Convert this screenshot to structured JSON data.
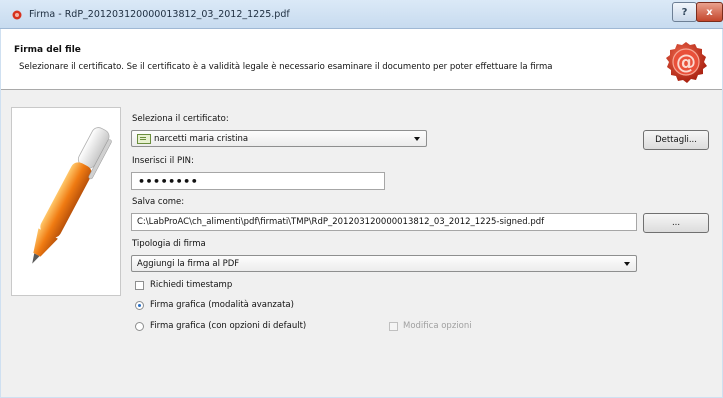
{
  "window": {
    "title": "Firma - RdP_201203120000013812_03_2012_1225.pdf",
    "help_label": "?",
    "close_label": "x"
  },
  "header": {
    "title": "Firma del file",
    "subtitle": "Selezionare il certificato. Se il certificato è a validità legale è necessario esaminare il documento per poter effettuare la firma"
  },
  "form": {
    "certificate_label": "Seleziona il certificato:",
    "certificate_value": "narcetti maria cristina",
    "details_button": "Dettagli...",
    "pin_label": "Inserisci il PIN:",
    "pin_value": "••••••••",
    "save_label": "Salva come:",
    "save_value": "C:\\LabProAC\\ch_alimenti\\pdf\\firmati\\TMP\\RdP_201203120000013812_03_2012_1225-signed.pdf",
    "browse_button": "...",
    "signature_type_label": "Tipologia di firma",
    "signature_type_value": "Aggiungi la firma al PDF",
    "timestamp_label": "Richiedi timestamp",
    "radio_advanced_label": "Firma grafica (modalità avanzata)",
    "radio_default_label": "Firma grafica (con opzioni di default)",
    "modify_options_label": "Modifica opzioni"
  },
  "icons": {
    "title": "firma-app-icon",
    "header": "at-seal-icon",
    "side": "pen-icon"
  },
  "colors": {
    "titlebar": "#cfe0f1",
    "close_button": "#c4462c",
    "seal": "#d7321e",
    "pen_orange": "#f07b12"
  }
}
